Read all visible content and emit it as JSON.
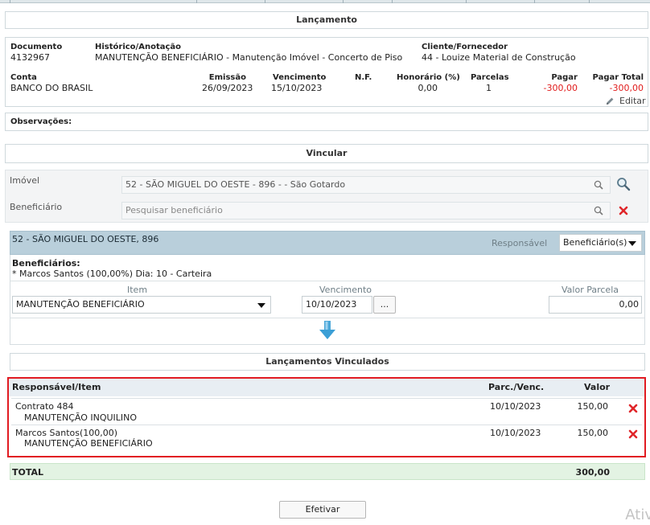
{
  "lancamento": {
    "title": "Lançamento",
    "documento_label": "Documento",
    "documento": "4132967",
    "historico_label": "Histórico/Anotação",
    "historico": "MANUTENÇÃO BENEFICIÁRIO - Manutenção Imóvel - Concerto de Piso",
    "cliente_label": "Cliente/Fornecedor",
    "cliente": "44 - Louize Material de Construção",
    "conta_label": "Conta",
    "conta": "BANCO DO BRASIL",
    "emissao_label": "Emissão",
    "emissao": "26/09/2023",
    "vencimento_label": "Vencimento",
    "vencimento": "15/10/2023",
    "nf_label": "N.F.",
    "honorario_label": "Honorário (%)",
    "honorario": "0,00",
    "parcelas_label": "Parcelas",
    "parcelas": "1",
    "pagar_label": "Pagar",
    "pagar": "-300,00",
    "pagar_total_label": "Pagar Total",
    "pagar_total": "-300,00",
    "editar_label": "Editar",
    "observacoes_label": "Observações:"
  },
  "vincular": {
    "title": "Vincular",
    "imovel_label": "Imóvel",
    "imovel_value": "52 - SÃO MIGUEL DO OESTE - 896 -  - São Gotardo",
    "beneficiario_label": "Beneficiário",
    "beneficiario_placeholder": "Pesquisar beneficiário"
  },
  "property": {
    "header": "52 - SÃO MIGUEL DO OESTE, 896",
    "responsavel_label": "Responsável",
    "responsavel_value": "Beneficiário(s)",
    "beneficiarios_label": "Beneficiários:",
    "beneficiarios_value": "* Marcos Santos (100,00%) Dia: 10 - Carteira",
    "item_label": "Item",
    "item_value": "MANUTENÇÃO BENEFICIÁRIO",
    "vencimento_label": "Vencimento",
    "vencimento_value": "10/10/2023",
    "dots_label": "...",
    "valor_parcela_label": "Valor Parcela",
    "valor_parcela_value": "0,00"
  },
  "vinculados": {
    "title": "Lançamentos Vinculados",
    "headers": {
      "item": "Responsável/Item",
      "venc": "Parc./Venc.",
      "valor": "Valor"
    },
    "rows": [
      {
        "responsavel": "Contrato 484",
        "item": "MANUTENÇÃO INQUILINO",
        "venc": "10/10/2023",
        "valor": "150,00"
      },
      {
        "responsavel": "Marcos Santos(100,00)",
        "item": "MANUTENÇÃO BENEFICIÁRIO",
        "venc": "10/10/2023",
        "valor": "150,00"
      }
    ],
    "total_label": "TOTAL",
    "total_value": "300,00"
  },
  "actions": {
    "efetivar_label": "Efetivar"
  },
  "overlay": {
    "ghost_text": "Ativ"
  },
  "colors": {
    "accent_red": "#e01b1b",
    "highlight_frame": "#e11b22",
    "property_bar": "#b9cfdb",
    "total_bar": "#e3f3e3"
  }
}
